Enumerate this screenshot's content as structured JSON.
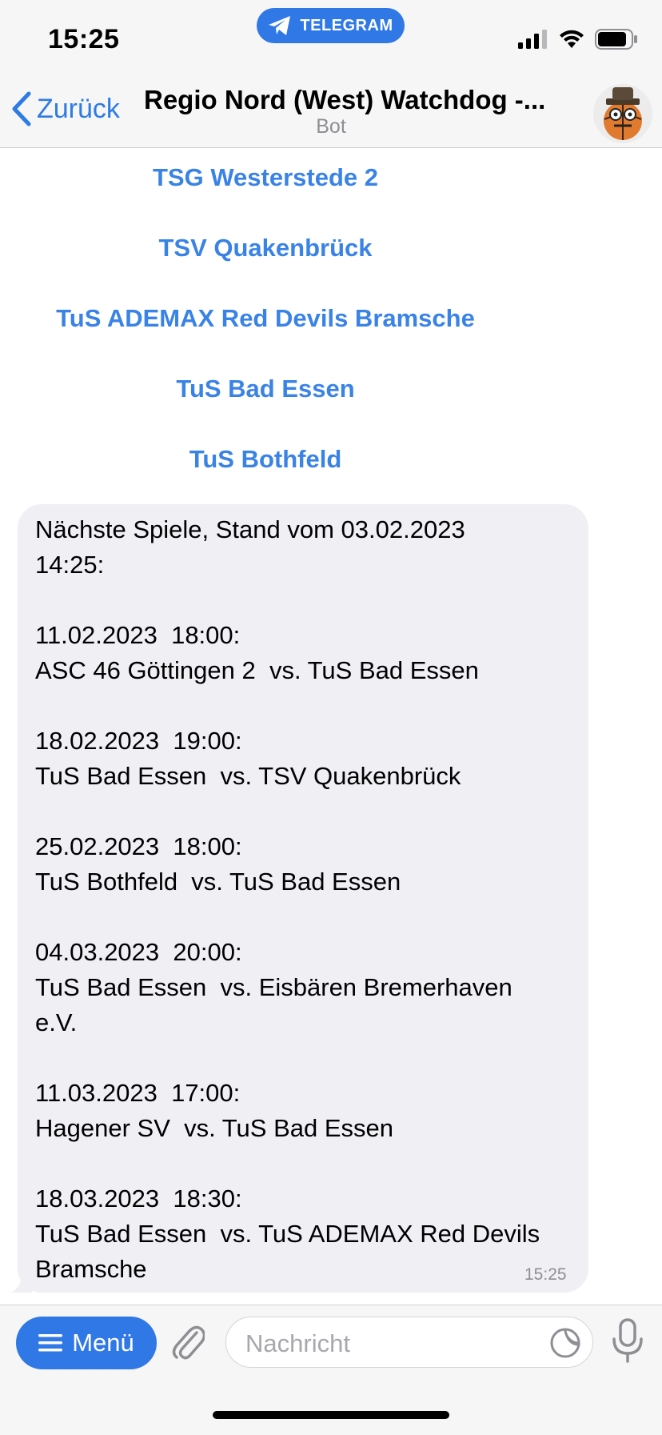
{
  "status_bar": {
    "time": "15:25",
    "app_pill": "TELEGRAM"
  },
  "nav": {
    "back_label": "Zurück",
    "title": "Regio Nord (West) Watchdog -...",
    "subtitle": "Bot"
  },
  "inline_buttons": [
    "TSG Westerstede 2",
    "TSV Quakenbrück",
    "TuS ADEMAX Red Devils Bramsche",
    "TuS Bad Essen",
    "TuS Bothfeld"
  ],
  "message": {
    "text": "Nächste Spiele, Stand vom 03.02.2023\n14:25:\n\n11.02.2023  18:00:\nASC 46 Göttingen 2  vs. TuS Bad Essen\n\n18.02.2023  19:00:\nTuS Bad Essen  vs. TSV Quakenbrück\n\n25.02.2023  18:00:\nTuS Bothfeld  vs. TuS Bad Essen\n\n04.03.2023  20:00:\nTuS Bad Essen  vs. Eisbären Bremerhaven\ne.V.\n\n11.03.2023  17:00:\nHagener SV  vs. TuS Bad Essen\n\n18.03.2023  18:30:\nTuS Bad Essen  vs. TuS ADEMAX Red Devils\nBramsche",
    "time": "15:25"
  },
  "input_bar": {
    "menu_label": "Menü",
    "placeholder": "Nachricht"
  },
  "colors": {
    "accent": "#2f78e6",
    "link": "#3a83e6",
    "bubble": "#efeff4"
  },
  "icons": [
    "telegram-icon",
    "signal-icon",
    "wifi-icon",
    "battery-icon",
    "back-chevron-icon",
    "bot-avatar",
    "menu-icon",
    "paperclip-icon",
    "sticker-icon",
    "microphone-icon"
  ]
}
